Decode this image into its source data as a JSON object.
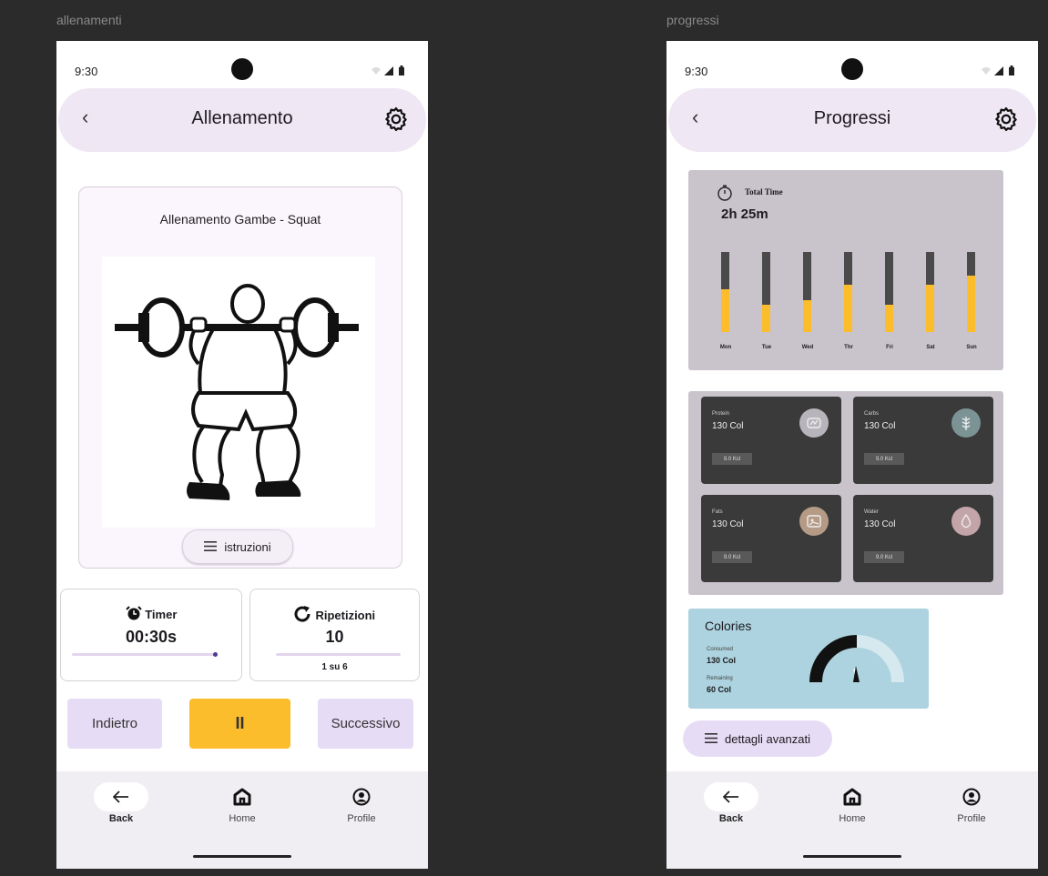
{
  "frames": {
    "left_label": "allenamenti",
    "right_label": "progressi"
  },
  "status": {
    "time": "9:30"
  },
  "workout": {
    "title": "Allenamento",
    "exercise_title": "Allenamento Gambe - Squat",
    "instructions_label": "istruzioni",
    "timer": {
      "label": "Timer",
      "value": "00:30s",
      "progress": 1.0
    },
    "reps": {
      "label": "Ripetizioni",
      "value": "10",
      "sub": "1 su 6",
      "progress": 0.0
    },
    "buttons": {
      "back": "Indietro",
      "pause": "II",
      "next": "Successivo"
    }
  },
  "progress": {
    "title": "Progressi",
    "total_time_label": "Total Time",
    "total_time_value": "2h  25m",
    "chart_data": {
      "type": "bar",
      "categories": [
        "Mon",
        "Tue",
        "Wed",
        "Thr",
        "Fri",
        "Sat",
        "Sun"
      ],
      "values": [
        0.53,
        0.34,
        0.4,
        0.59,
        0.34,
        0.59,
        0.7
      ],
      "ylim": [
        0,
        1
      ]
    },
    "macros": [
      {
        "label": "Protein",
        "value": "130 Col",
        "chip": "9.0 Kcl",
        "icon": "protein-icon",
        "color": "#b8b4bb"
      },
      {
        "label": "Carbs",
        "value": "130 Col",
        "chip": "9.0 Kcl",
        "icon": "wheat-icon",
        "color": "#7c9396"
      },
      {
        "label": "Fats",
        "value": "130 Col",
        "chip": "9.0 Kcl",
        "icon": "fats-icon",
        "color": "#b59b85"
      },
      {
        "label": "Water",
        "value": "130 Col",
        "chip": "9.0 Kcl",
        "icon": "water-drop-icon",
        "color": "#c3a4a9"
      }
    ],
    "calories": {
      "title": "Colories",
      "consumed_label": "Consumed",
      "consumed_value": "130 Col",
      "remaining_label": "Remaining",
      "remaining_value": "60 Col",
      "consumed_fraction": 0.5
    },
    "advanced_label": "dettagli avanzati"
  },
  "nav": {
    "back": "Back",
    "home": "Home",
    "profile": "Profile"
  }
}
